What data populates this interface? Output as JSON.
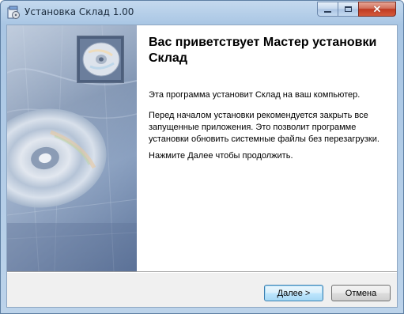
{
  "window": {
    "title": "Установка Склад 1.00",
    "close_symbol": "✕"
  },
  "icons": {
    "app": "installer-icon",
    "logo": "cd-disc-icon",
    "minimize": "minimize-icon",
    "maximize": "maximize-icon",
    "close": "close-icon"
  },
  "wizard": {
    "heading": "Вас приветствует Мастер установки Склад",
    "intro": "Эта программа установит Склад на ваш компьютер.",
    "advice": "Перед началом установки рекомендуется закрыть все запущенные приложения. Это позволит программе установки обновить системные файлы без перезагрузки.",
    "instruction": "Нажмите Далее чтобы продолжить."
  },
  "buttons": {
    "next": "Далее >",
    "cancel": "Отмена"
  },
  "colors": {
    "title_bar": "#b9d1ea",
    "close_button": "#c7432b",
    "sidebar": "#6f86a8",
    "content_background": "#ffffff"
  }
}
